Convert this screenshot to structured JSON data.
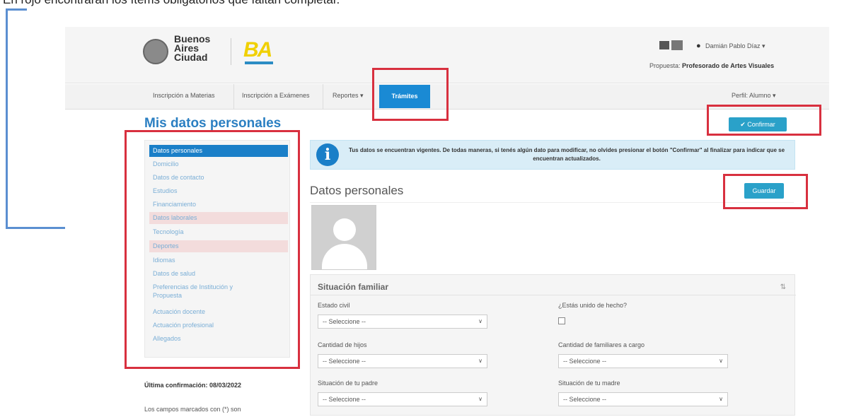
{
  "caption": "En rojo encontrarán los ítems obligatorios que faltan completar.",
  "header": {
    "logo_text": "Buenos Aires Ciudad",
    "ba_logo": "BA",
    "user_name": "Damián Pablo Díaz ▾",
    "propuesta_label": "Propuesta:",
    "propuesta_value": "Profesorado de Artes Visuales"
  },
  "nav": {
    "items": [
      "Inscripción a Materias",
      "Inscripción a Exámenes",
      "Reportes ▾",
      "Trámites"
    ],
    "profile": "Perfil: Alumno ▾"
  },
  "page_title": "Mis datos personales",
  "confirm_label": "✔ Confirmar",
  "save_label": "Guardar",
  "sidebar": {
    "items": [
      "Datos personales",
      "Domicilio",
      "Datos de contacto",
      "Estudios",
      "Financiamiento",
      "Datos laborales",
      "Tecnología",
      "Deportes",
      "Idiomas",
      "Datos de salud",
      "Preferencias de Institución y",
      "Propuesta",
      "Actuación docente",
      "Actuación profesional",
      "Allegados"
    ]
  },
  "info": {
    "text": "Tus datos se encuentran vigentes. De todas maneras, si tenés algún dato para modificar, no olvides presionar el botón \"Confirmar\" al finalizar para indicar que se encuentran actualizados."
  },
  "section_title": "Datos personales",
  "family": {
    "title": "Situación familiar",
    "fields": [
      {
        "label": "Estado civil",
        "value": "-- Seleccione --"
      },
      {
        "label": "¿Estás unido de hecho?",
        "value": ""
      },
      {
        "label": "Cantidad de hijos",
        "value": "-- Seleccione --"
      },
      {
        "label": "Cantidad de familiares a cargo",
        "value": "-- Seleccione --"
      },
      {
        "label": "Situación de tu padre",
        "value": "-- Seleccione --"
      },
      {
        "label": "Situación de tu madre",
        "value": "-- Seleccione --"
      }
    ]
  },
  "last_confirm": "Última confirmación: 08/03/2022",
  "fields_note": "Los campos marcados con (*) son",
  "colors": {
    "accent": "#1a8ad4",
    "highlight": "#d8303f",
    "arrow": "#5b8fd1"
  }
}
